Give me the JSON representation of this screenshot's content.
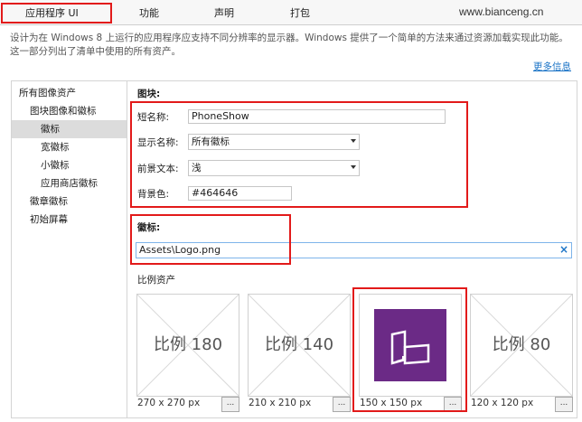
{
  "tabs": [
    "应用程序 UI",
    "功能",
    "声明",
    "打包"
  ],
  "watermark": "www.bianceng.cn",
  "description": "设计为在 Windows 8 上运行的应用程序应支持不同分辨率的显示器。Windows 提供了一个简单的方法来通过资源加载实现此功能。这一部分列出了清单中使用的所有资产。",
  "more_info": "更多信息",
  "nav": {
    "items": [
      "所有图像资产",
      "图块图像和徽标",
      "徽标",
      "宽徽标",
      "小徽标",
      "应用商店徽标",
      "徽章徽标",
      "初始屏幕"
    ],
    "selected_index": 2
  },
  "tile_section": {
    "heading": "图块:",
    "short_name_label": "短名称:",
    "short_name_value": "PhoneShow",
    "display_name_label": "显示名称:",
    "display_name_value": "所有徽标",
    "foreground_label": "前景文本:",
    "foreground_value": "浅",
    "background_label": "背景色:",
    "background_value": "#464646"
  },
  "logo_section": {
    "heading": "徽标:",
    "path": "Assets\\Logo.png",
    "clear": "×"
  },
  "scale_section": {
    "heading": "比例资产",
    "tiles": [
      {
        "label": "比例 180",
        "size": "270 x 270 px",
        "browse": "..."
      },
      {
        "label": "比例 140",
        "size": "210 x 210 px",
        "browse": "..."
      },
      {
        "label": "",
        "size": "150 x 150 px",
        "browse": "..."
      },
      {
        "label": "比例 80",
        "size": "120 x 120 px",
        "browse": "..."
      }
    ]
  },
  "colors": {
    "highlight": "#e21a1a",
    "logo_bg": "#6b2a86",
    "link": "#1a73c6"
  }
}
